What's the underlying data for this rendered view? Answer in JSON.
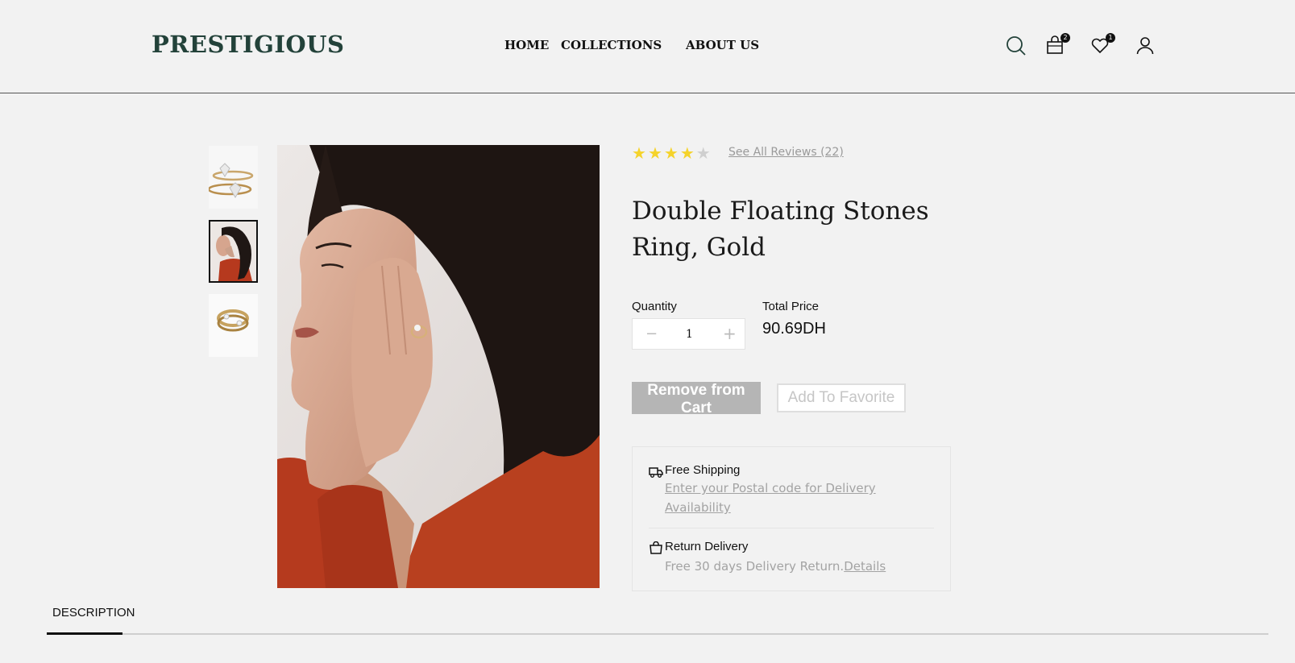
{
  "header": {
    "logo": "PRESTIGIOUS",
    "nav": [
      "HOME",
      "COLLECTIONS",
      "ABOUT US"
    ],
    "cart_count": "2",
    "wishlist_count": "1"
  },
  "product": {
    "rating": 4,
    "rating_max": 5,
    "reviews_link": "See All Reviews (22)",
    "title": "Double Floating Stones Ring, Gold",
    "quantity_label": "Quantity",
    "quantity": "1",
    "minus": "−",
    "plus": "+",
    "total_label": "Total Price",
    "total_value": "90.69DH",
    "remove_label": "Remove from Cart",
    "favorite_label": "Add To Favorite"
  },
  "info": {
    "shipping_title": "Free Shipping",
    "shipping_link": "Enter your Postal code for Delivery Availability",
    "return_title": "Return Delivery",
    "return_text": "Free 30 days Delivery Return.",
    "return_link": "Details"
  },
  "tabs": [
    "DESCRIPTION"
  ],
  "colors": {
    "brand": "#23423a",
    "star": "#f5d32b",
    "button_gray": "#b5b5b5"
  },
  "icons": [
    "search-icon",
    "cart-icon",
    "heart-icon",
    "user-icon",
    "truck-icon",
    "bag-icon"
  ]
}
